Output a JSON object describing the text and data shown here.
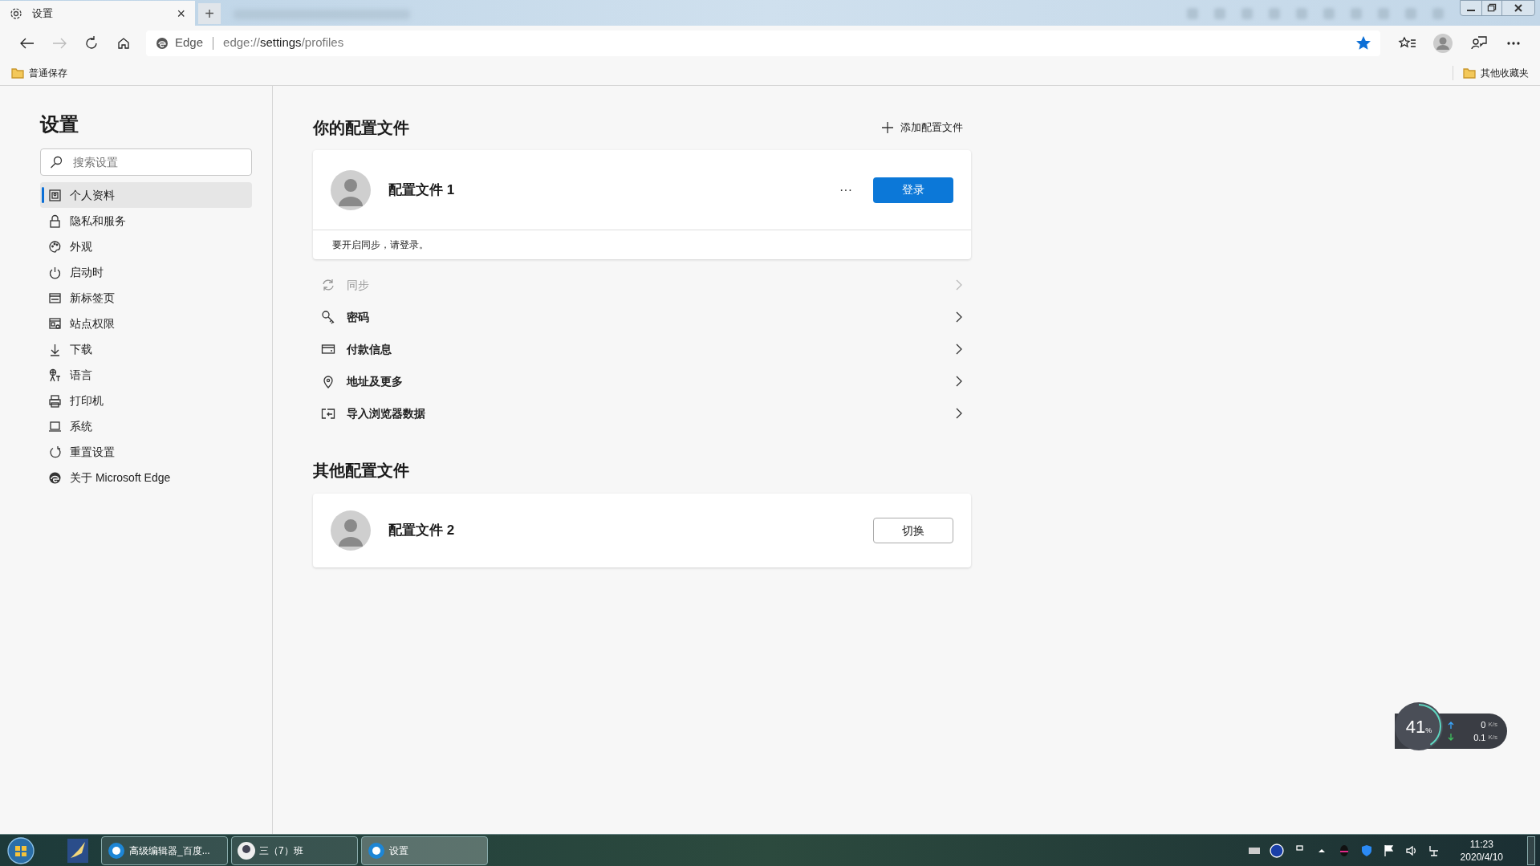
{
  "tab": {
    "title": "设置",
    "close": "×",
    "new_tab": "+"
  },
  "address_bar": {
    "site": "Edge",
    "url_prefix": "edge://",
    "url_host": "settings",
    "url_path": "/profiles",
    "favorited": true
  },
  "bookmarks": {
    "left": "普通保存",
    "right": "其他收藏夹"
  },
  "sidebar": {
    "title": "设置",
    "search_placeholder": "搜索设置",
    "items": [
      {
        "label": "个人资料",
        "selected": true
      },
      {
        "label": "隐私和服务",
        "selected": false
      },
      {
        "label": "外观",
        "selected": false
      },
      {
        "label": "启动时",
        "selected": false
      },
      {
        "label": "新标签页",
        "selected": false
      },
      {
        "label": "站点权限",
        "selected": false
      },
      {
        "label": "下载",
        "selected": false
      },
      {
        "label": "语言",
        "selected": false
      },
      {
        "label": "打印机",
        "selected": false
      },
      {
        "label": "系统",
        "selected": false
      },
      {
        "label": "重置设置",
        "selected": false
      },
      {
        "label": "关于 Microsoft Edge",
        "selected": false
      }
    ]
  },
  "main": {
    "title": "你的配置文件",
    "add_profile": "添加配置文件",
    "profile": {
      "name": "配置文件 1",
      "more": "···",
      "sign_in": "登录",
      "note": "要开启同步，请登录。"
    },
    "rows": [
      {
        "label": "同步",
        "disabled": true
      },
      {
        "label": "密码",
        "disabled": false
      },
      {
        "label": "付款信息",
        "disabled": false
      },
      {
        "label": "地址及更多",
        "disabled": false
      },
      {
        "label": "导入浏览器数据",
        "disabled": false
      }
    ],
    "other_title": "其他配置文件",
    "other_profile": {
      "name": "配置文件 2",
      "switch": "切换"
    }
  },
  "net_widget": {
    "percent": "41",
    "percent_sign": "%",
    "level": 0.41,
    "up": "0",
    "up_unit": "K/s",
    "down": "0.1",
    "down_unit": "K/s"
  },
  "taskbar": {
    "windows": [
      {
        "label": "高级编辑器_百度...",
        "selected": false
      },
      {
        "label": "三（7）班",
        "selected": false
      },
      {
        "label": "设置",
        "selected": true
      }
    ],
    "time": "11:23",
    "date": "2020/4/10"
  }
}
